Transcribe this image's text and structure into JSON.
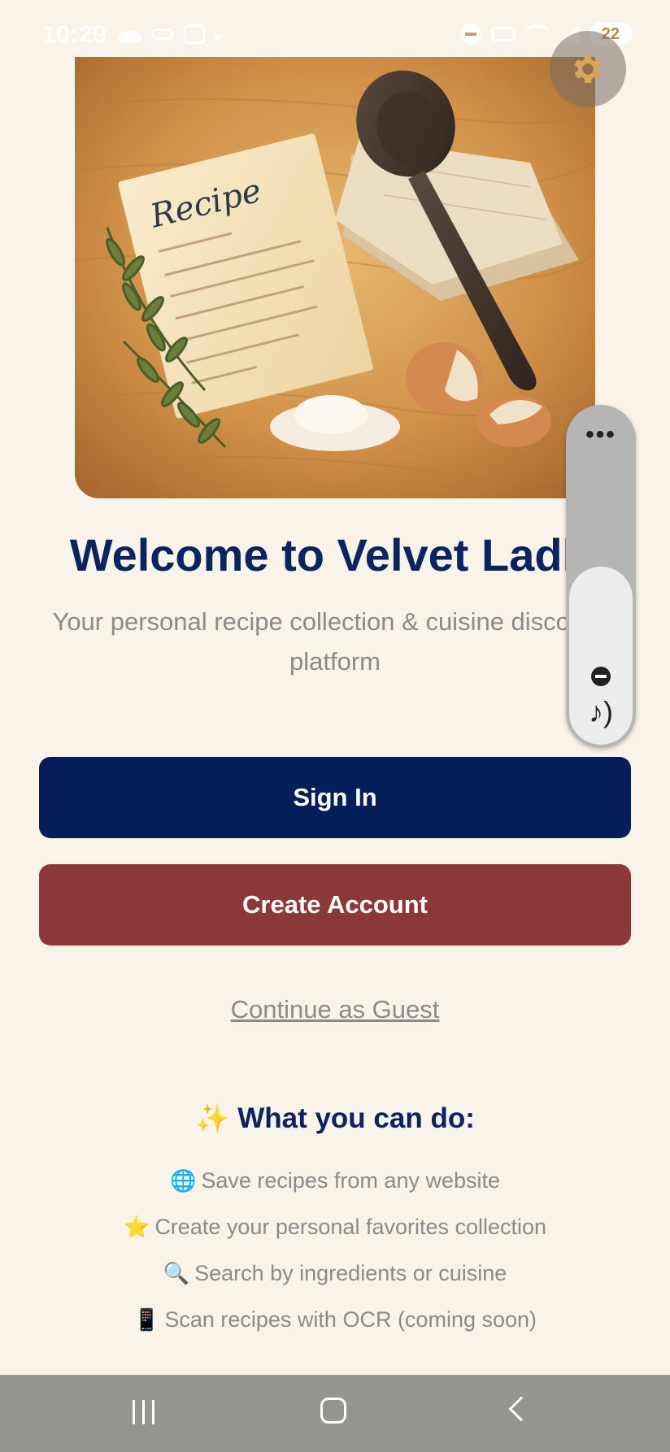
{
  "status_bar": {
    "time": "10:29",
    "battery": "22",
    "icons": [
      "cloud-icon",
      "voicemail-icon",
      "screenshot-icon",
      "dot-icon",
      "dnd-icon",
      "key-icon",
      "wifi-icon",
      "signal-icon",
      "battery-icon"
    ]
  },
  "hero": {
    "paper_heading": "Recipe"
  },
  "welcome": {
    "title": "Welcome to Velvet Ladle",
    "subtitle": "Your personal recipe collection & cuisine discovery platform"
  },
  "buttons": {
    "sign_in": "Sign In",
    "create_account": "Create Account",
    "guest": "Continue as Guest"
  },
  "features": {
    "heading_emoji": "✨",
    "heading": "What you can do:",
    "items": [
      {
        "emoji": "🌐",
        "text": "Save recipes from any website"
      },
      {
        "emoji": "⭐",
        "text": "Create your personal favorites collection"
      },
      {
        "emoji": "🔍",
        "text": "Search by ingredients or cuisine"
      },
      {
        "emoji": "📱",
        "text": "Scan recipes with OCR (coming soon)"
      }
    ]
  },
  "volume_panel": {
    "more": "•••",
    "level": 0.53
  },
  "colors": {
    "background": "#f9f3ea",
    "primary": "#041e5a",
    "secondary": "#8c3838",
    "title": "#0a2460",
    "muted": "#8a8a8a",
    "nav_bar": "#979590"
  }
}
